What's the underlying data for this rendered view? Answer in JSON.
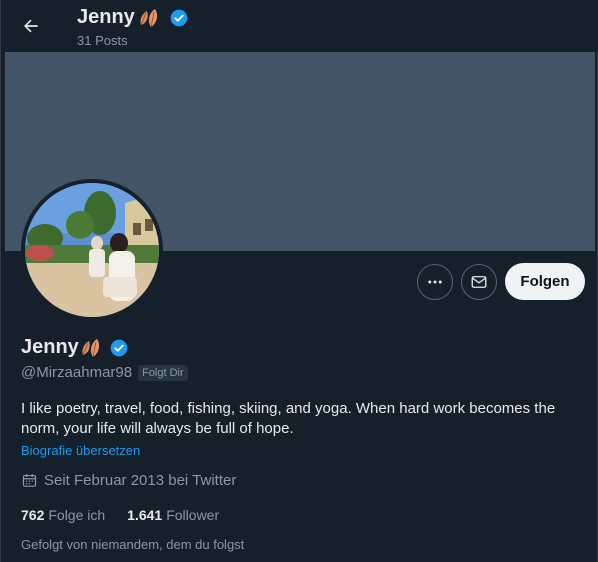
{
  "header": {
    "name": "Jenny",
    "posts_count": "31 Posts"
  },
  "profile": {
    "name": "Jenny",
    "handle": "@Mirzaahmar98",
    "follows_you_badge": "Folgt Dir",
    "bio": "I like poetry, travel, food, fishing, skiing, and yoga. When hard work becomes the norm, your life will always be full of hope.",
    "translate_link": "Biografie übersetzen",
    "joined": "Seit Februar 2013 bei Twitter",
    "following_count": "762",
    "following_label": "Folge ich",
    "followers_count": "1.641",
    "followers_label": "Follower",
    "followed_by_text": "Gefolgt von niemandem, dem du folgst"
  },
  "actions": {
    "follow_label": "Folgen"
  },
  "icons": {
    "back": "arrow-left-icon",
    "more": "more-horizontal-icon",
    "message": "mail-icon",
    "calendar": "calendar-icon",
    "verified": "verified-badge-icon",
    "leaves": "leaves-emoji-icon"
  },
  "colors": {
    "background": "#15202b",
    "banner": "#425466",
    "accent": "#1d9bf0",
    "muted_text": "#8b98a5",
    "follow_button_bg": "#eff3f4"
  }
}
